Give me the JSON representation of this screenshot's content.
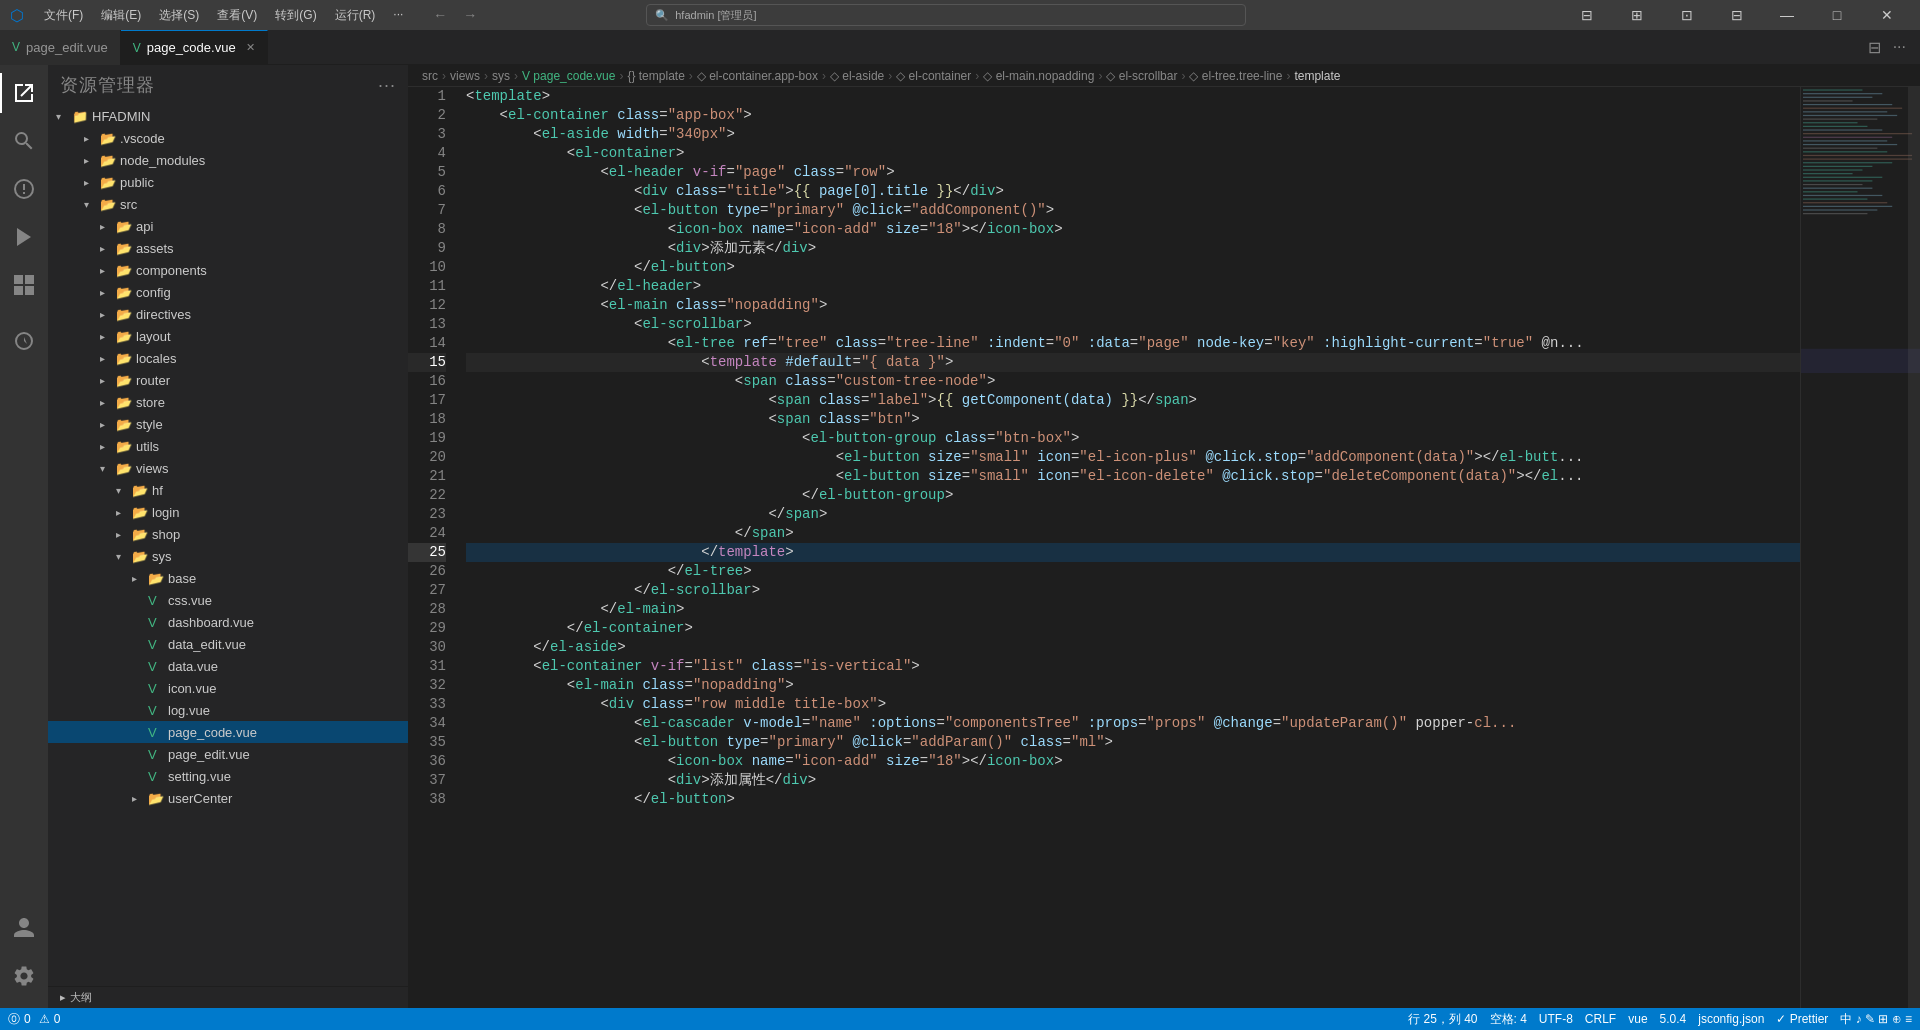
{
  "titlebar": {
    "menus": [
      "文件(F)",
      "编辑(E)",
      "选择(S)",
      "查看(V)",
      "转到(G)",
      "运行(R)",
      "···"
    ],
    "search_placeholder": "hfadmin [管理员]",
    "back": "←",
    "forward": "→",
    "actions": [
      "□□",
      "□",
      "□□",
      "□□",
      "—",
      "□",
      "✕"
    ]
  },
  "tabs": [
    {
      "id": "page_edit",
      "label": "page_edit.vue",
      "active": false,
      "dirty": false,
      "icon": "vue"
    },
    {
      "id": "page_code",
      "label": "page_code.vue",
      "active": true,
      "dirty": true,
      "icon": "vue"
    }
  ],
  "breadcrumb": {
    "parts": [
      "src",
      "views",
      "sys",
      "page_code.vue",
      "{} template",
      "el-container.app-box",
      "el-aside",
      "el-container",
      "el-main.nopadding",
      "el-scrollbar",
      "el-tree.tree-line",
      "template"
    ]
  },
  "sidebar": {
    "title": "资源管理器",
    "root": "HFADMIN",
    "items": [
      {
        "id": "vscode",
        "label": ".vscode",
        "type": "folder",
        "indent": 1,
        "open": false
      },
      {
        "id": "node_modules",
        "label": "node_modules",
        "type": "folder",
        "indent": 1,
        "open": false
      },
      {
        "id": "public",
        "label": "public",
        "type": "folder",
        "indent": 1,
        "open": false
      },
      {
        "id": "src",
        "label": "src",
        "type": "folder",
        "indent": 1,
        "open": true
      },
      {
        "id": "api",
        "label": "api",
        "type": "folder",
        "indent": 2,
        "open": false
      },
      {
        "id": "assets",
        "label": "assets",
        "type": "folder",
        "indent": 2,
        "open": false
      },
      {
        "id": "components",
        "label": "components",
        "type": "folder",
        "indent": 2,
        "open": false
      },
      {
        "id": "config",
        "label": "config",
        "type": "folder",
        "indent": 2,
        "open": false
      },
      {
        "id": "directives",
        "label": "directives",
        "type": "folder",
        "indent": 2,
        "open": false
      },
      {
        "id": "layout",
        "label": "layout",
        "type": "folder",
        "indent": 2,
        "open": false
      },
      {
        "id": "locales",
        "label": "locales",
        "type": "folder",
        "indent": 2,
        "open": false
      },
      {
        "id": "router",
        "label": "router",
        "type": "folder",
        "indent": 2,
        "open": false
      },
      {
        "id": "store",
        "label": "store",
        "type": "folder",
        "indent": 2,
        "open": false
      },
      {
        "id": "style",
        "label": "style",
        "type": "folder",
        "indent": 2,
        "open": false
      },
      {
        "id": "utils",
        "label": "utils",
        "type": "folder",
        "indent": 2,
        "open": false
      },
      {
        "id": "views",
        "label": "views",
        "type": "folder",
        "indent": 2,
        "open": true
      },
      {
        "id": "hf",
        "label": "hf",
        "type": "folder",
        "indent": 3,
        "open": true
      },
      {
        "id": "login",
        "label": "login",
        "type": "folder",
        "indent": 3,
        "open": false
      },
      {
        "id": "shop",
        "label": "shop",
        "type": "folder",
        "indent": 3,
        "open": false
      },
      {
        "id": "sys",
        "label": "sys",
        "type": "folder",
        "indent": 3,
        "open": true
      },
      {
        "id": "base",
        "label": "base",
        "type": "folder",
        "indent": 4,
        "open": false
      },
      {
        "id": "css_vue",
        "label": "css.vue",
        "type": "vue",
        "indent": 4,
        "open": false
      },
      {
        "id": "dashboard_vue",
        "label": "dashboard.vue",
        "type": "vue",
        "indent": 4,
        "open": false
      },
      {
        "id": "data_edit_vue",
        "label": "data_edit.vue",
        "type": "vue",
        "indent": 4,
        "open": false
      },
      {
        "id": "data_vue",
        "label": "data.vue",
        "type": "vue",
        "indent": 4,
        "open": false
      },
      {
        "id": "icon_vue",
        "label": "icon.vue",
        "type": "vue",
        "indent": 4,
        "open": false
      },
      {
        "id": "log_vue",
        "label": "log.vue",
        "type": "vue",
        "indent": 4,
        "open": false
      },
      {
        "id": "page_code_vue",
        "label": "page_code.vue",
        "type": "vue",
        "indent": 4,
        "open": false,
        "active": true
      },
      {
        "id": "page_edit_vue",
        "label": "page_edit.vue",
        "type": "vue",
        "indent": 4,
        "open": false
      },
      {
        "id": "setting_vue",
        "label": "setting.vue",
        "type": "vue",
        "indent": 4,
        "open": false
      },
      {
        "id": "userCenter",
        "label": "userCenter",
        "type": "folder",
        "indent": 4,
        "open": false
      }
    ],
    "footer": "大纲"
  },
  "code": {
    "lines": [
      {
        "num": 1,
        "content": "<template>"
      },
      {
        "num": 2,
        "content": "    <el-container class=\"app-box\">"
      },
      {
        "num": 3,
        "content": "        <el-aside width=\"340px\">"
      },
      {
        "num": 4,
        "content": "            <el-container>"
      },
      {
        "num": 5,
        "content": "                <el-header v-if=\"page\" class=\"row\">"
      },
      {
        "num": 6,
        "content": "                    <div class=\"title\">{{ page[0].title }}</div>"
      },
      {
        "num": 7,
        "content": "                    <el-button type=\"primary\" @click=\"addComponent()\">"
      },
      {
        "num": 8,
        "content": "                        <icon-box name=\"icon-add\" size=\"18\"></icon-box>"
      },
      {
        "num": 9,
        "content": "                        <div>添加元素</div>"
      },
      {
        "num": 10,
        "content": "                    </el-button>"
      },
      {
        "num": 11,
        "content": "                </el-header>"
      },
      {
        "num": 12,
        "content": "                <el-main class=\"nopadding\">"
      },
      {
        "num": 13,
        "content": "                    <el-scrollbar>"
      },
      {
        "num": 14,
        "content": "                        <el-tree ref=\"tree\" class=\"tree-line\" :indent=\"0\" :data=\"page\" node-key=\"key\" :highlight-current=\"true\" @n..."
      },
      {
        "num": 15,
        "content": "                            <template #default=\"{ data }\">"
      },
      {
        "num": 16,
        "content": "                                <span class=\"custom-tree-node\">"
      },
      {
        "num": 17,
        "content": "                                    <span class=\"label\">{{ getComponent(data) }}</span>"
      },
      {
        "num": 18,
        "content": "                                    <span class=\"btn\">"
      },
      {
        "num": 19,
        "content": "                                        <el-button-group class=\"btn-box\">"
      },
      {
        "num": 20,
        "content": "                                            <el-button size=\"small\" icon=\"el-icon-plus\" @click.stop=\"addComponent(data)\"></el-butt..."
      },
      {
        "num": 21,
        "content": "                                            <el-button size=\"small\" icon=\"el-icon-delete\" @click.stop=\"deleteComponent(data)\"></el..."
      },
      {
        "num": 22,
        "content": "                                        </el-button-group>"
      },
      {
        "num": 23,
        "content": "                                    </span>"
      },
      {
        "num": 24,
        "content": "                                </span>"
      },
      {
        "num": 25,
        "content": "                            </template>"
      },
      {
        "num": 26,
        "content": "                        </el-tree>"
      },
      {
        "num": 27,
        "content": "                    </el-scrollbar>"
      },
      {
        "num": 28,
        "content": "                </el-main>"
      },
      {
        "num": 29,
        "content": "            </el-container>"
      },
      {
        "num": 30,
        "content": "        </el-aside>"
      },
      {
        "num": 31,
        "content": "        <el-container v-if=\"list\" class=\"is-vertical\">"
      },
      {
        "num": 32,
        "content": "            <el-main class=\"nopadding\">"
      },
      {
        "num": 33,
        "content": "                <div class=\"row middle title-box\">"
      },
      {
        "num": 34,
        "content": "                    <el-cascader v-model=\"name\" :options=\"componentsTree\" :props=\"props\" @change=\"updateParam()\" popper-cl..."
      },
      {
        "num": 35,
        "content": "                    <el-button type=\"primary\" @click=\"addParam()\" class=\"ml\">"
      },
      {
        "num": 36,
        "content": "                        <icon-box name=\"icon-add\" size=\"18\"></icon-box>"
      },
      {
        "num": 37,
        "content": "                        <div>添加属性</div>"
      },
      {
        "num": 38,
        "content": "                    </el-button>"
      }
    ]
  },
  "statusbar": {
    "errors": "⓪ 0",
    "warnings": "⚠ 0",
    "row_col": "行 25，列 40",
    "spaces": "空格: 4",
    "encoding": "UTF-8",
    "line_ending": "CRLF",
    "language": "vue",
    "version": "5.0.4",
    "config": "jsconfig.json",
    "formatter": "✓ Prettier",
    "extras": "中 ♪ ✎ ⊞ ⊕ ≡"
  }
}
